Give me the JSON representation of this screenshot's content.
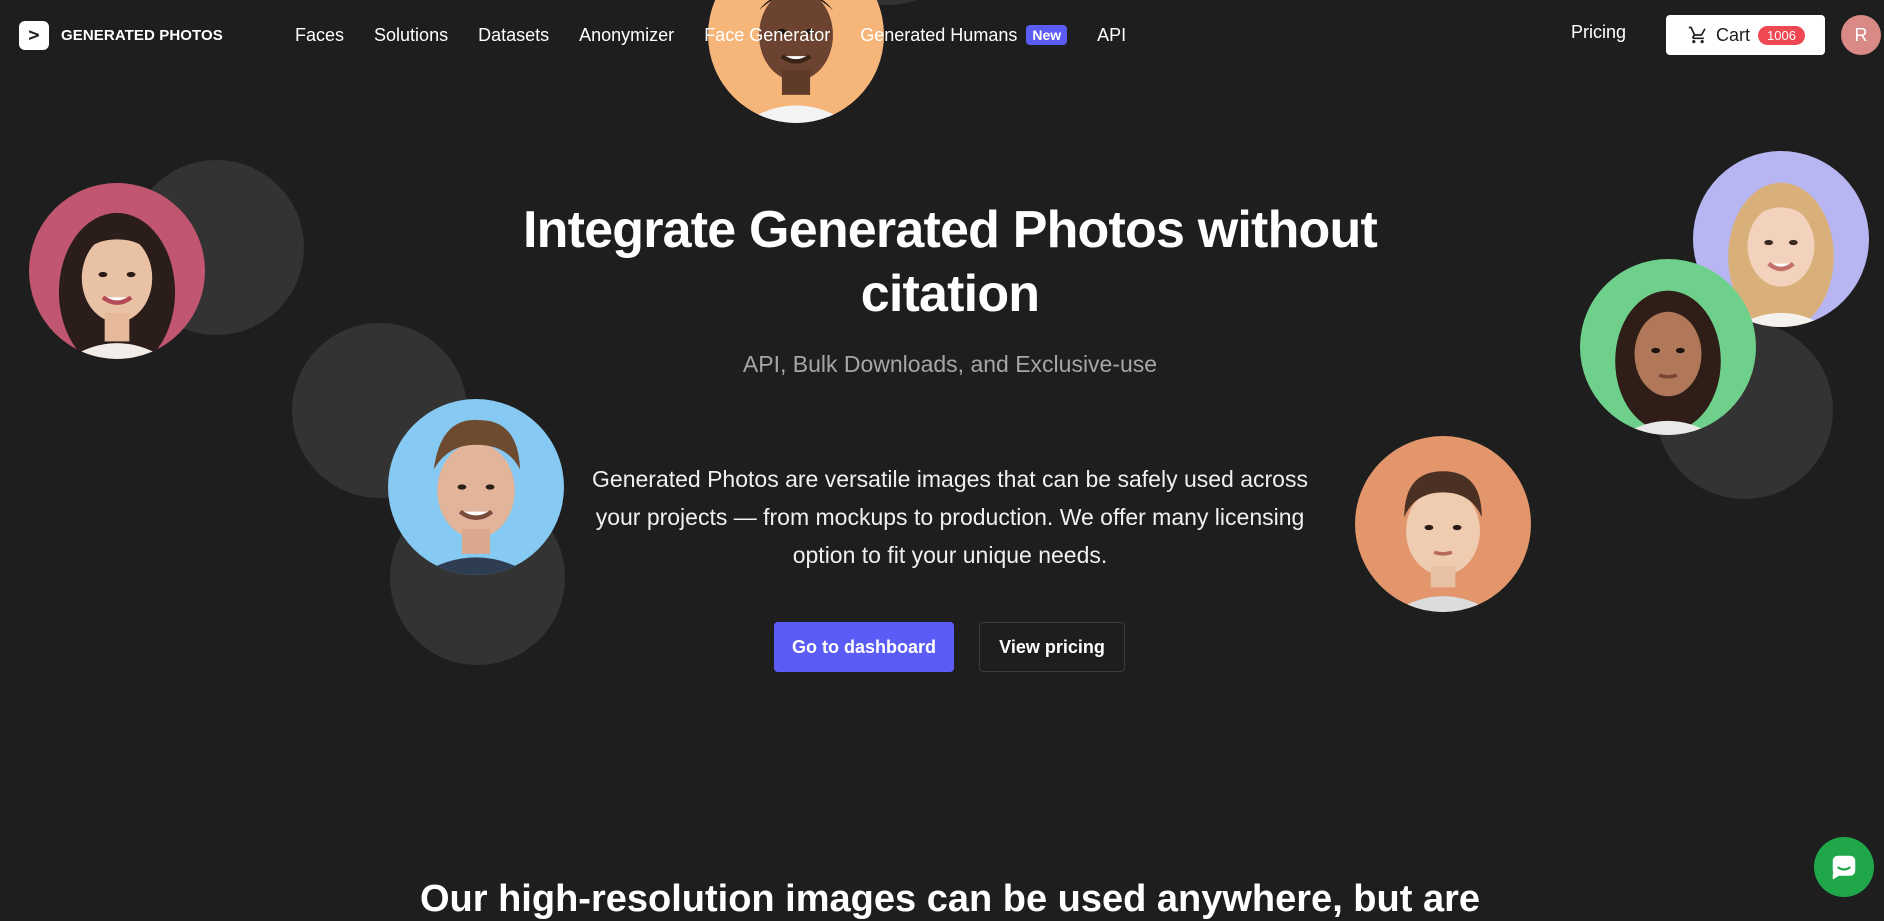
{
  "header": {
    "logo_mark": ">",
    "logo_text": "GENERATED PHOTOS",
    "nav": [
      {
        "label": "Faces"
      },
      {
        "label": "Solutions"
      },
      {
        "label": "Datasets"
      },
      {
        "label": "Anonymizer"
      },
      {
        "label": "Face Generator"
      },
      {
        "label": "Generated Humans",
        "badge": "New"
      },
      {
        "label": "API"
      }
    ],
    "pricing": "Pricing",
    "cart": {
      "label": "Cart",
      "count": "1006"
    },
    "avatar_initial": "R"
  },
  "hero": {
    "title": "Integrate Generated Photos without citation",
    "subtitle": "API, Bulk Downloads, and Exclusive-use",
    "body": "Generated Photos are versatile images that can be safely used across your projects — from mockups to production. We offer many licensing option to fit your unique needs.",
    "primary_button": "Go to dashboard",
    "secondary_button": "View pricing"
  },
  "section": {
    "heading": "Our high-resolution images can be used anywhere, but are"
  },
  "colors": {
    "background": "#1e1e1e",
    "accent": "#5b5cf6",
    "badge_red": "#ef4852",
    "chat_green": "#1fa74a"
  },
  "icons": [
    "cart-icon",
    "chat-icon"
  ]
}
